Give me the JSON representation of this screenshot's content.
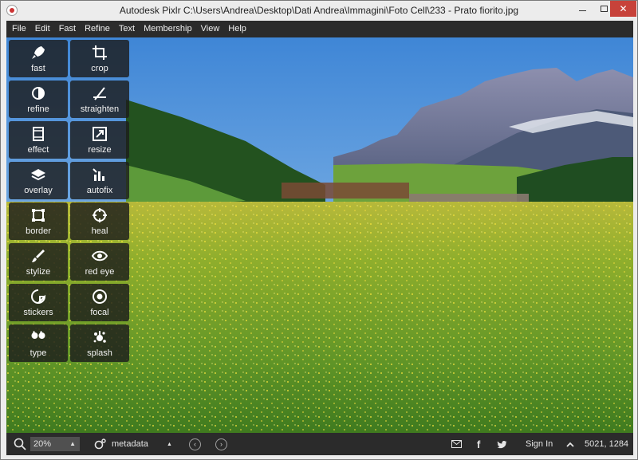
{
  "window": {
    "title": "Autodesk Pixlr   C:\\Users\\Andrea\\Desktop\\Dati Andrea\\Immagini\\Foto Cell\\233 - Prato fiorito.jpg"
  },
  "menu": [
    "File",
    "Edit",
    "Fast",
    "Refine",
    "Text",
    "Membership",
    "View",
    "Help"
  ],
  "tools": [
    {
      "label": "fast",
      "icon": "rocket-icon"
    },
    {
      "label": "crop",
      "icon": "crop-icon"
    },
    {
      "label": "refine",
      "icon": "refine-icon"
    },
    {
      "label": "straighten",
      "icon": "straighten-icon"
    },
    {
      "label": "effect",
      "icon": "film-icon"
    },
    {
      "label": "resize",
      "icon": "resize-icon"
    },
    {
      "label": "overlay",
      "icon": "layers-icon"
    },
    {
      "label": "autofix",
      "icon": "autofix-icon"
    },
    {
      "label": "border",
      "icon": "border-icon"
    },
    {
      "label": "heal",
      "icon": "heal-icon"
    },
    {
      "label": "stylize",
      "icon": "brush-icon"
    },
    {
      "label": "red eye",
      "icon": "eye-icon"
    },
    {
      "label": "stickers",
      "icon": "sticker-icon"
    },
    {
      "label": "focal",
      "icon": "focal-icon"
    },
    {
      "label": "type",
      "icon": "quote-icon"
    },
    {
      "label": "splash",
      "icon": "splash-icon"
    }
  ],
  "bottom_bar": {
    "zoom": "20%",
    "metadata_label": "metadata",
    "sign_in": "Sign In",
    "image_size": "5021, 1284"
  },
  "colors": {
    "toolbar_bg": "#2b2b2b",
    "close_button": "#c7423a",
    "tool_bg": "#1c1c1c"
  }
}
